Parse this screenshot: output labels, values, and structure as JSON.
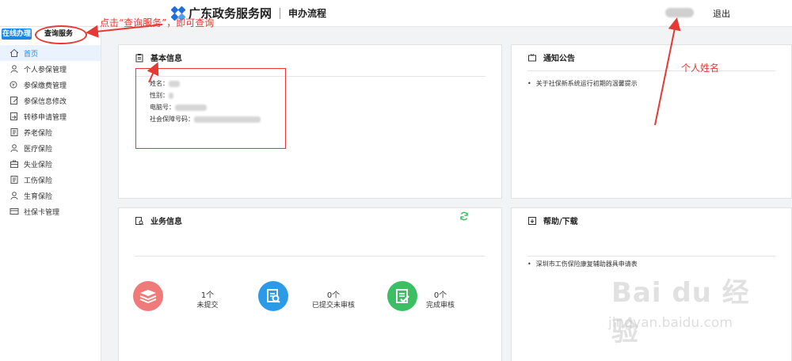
{
  "header": {
    "site_title": "广东政务服务网",
    "nav_link": "申办流程",
    "logout": "退出"
  },
  "sidebar": {
    "tab_online": "在线办理",
    "tab_query": "查询服务",
    "items": [
      {
        "label": "首页",
        "icon": "home-icon",
        "active": true
      },
      {
        "label": "个人参保管理",
        "icon": "person-icon"
      },
      {
        "label": "参保缴费管理",
        "icon": "payment-icon"
      },
      {
        "label": "参保信息修改",
        "icon": "edit-icon"
      },
      {
        "label": "转移申请管理",
        "icon": "transfer-icon"
      },
      {
        "label": "养老保险",
        "icon": "document-icon"
      },
      {
        "label": "医疗保险",
        "icon": "person-icon"
      },
      {
        "label": "失业保险",
        "icon": "briefcase-icon"
      },
      {
        "label": "工伤保险",
        "icon": "document-icon"
      },
      {
        "label": "生育保险",
        "icon": "person-icon"
      },
      {
        "label": "社保卡管理",
        "icon": "card-icon"
      }
    ]
  },
  "basic_info": {
    "title": "基本信息",
    "fields": [
      {
        "label": "姓名："
      },
      {
        "label": "性别："
      },
      {
        "label": "电脑号："
      },
      {
        "label": "社会保障号码："
      }
    ]
  },
  "notices": {
    "title": "通知公告",
    "items": [
      "关于社保新系统运行初期的温馨提示"
    ]
  },
  "business": {
    "title": "业务信息",
    "stats": [
      {
        "count": "1个",
        "label": "未提交",
        "color": "#f07a7a"
      },
      {
        "count": "0个",
        "label": "已提交未审核",
        "color": "#2b9be8"
      },
      {
        "count": "0个",
        "label": "完成审核",
        "color": "#3cbf63"
      }
    ]
  },
  "help": {
    "title": "帮助/下载",
    "items": [
      "深圳市工伤保险康复辅助器具申请表"
    ]
  },
  "annotations": {
    "query_hint": "点击“查询服务”，即可查询",
    "name_hint": "个人姓名",
    "color": "#e53935"
  },
  "watermark": {
    "main": "Bai du 经验",
    "sub": "jingyan.baidu.com"
  }
}
